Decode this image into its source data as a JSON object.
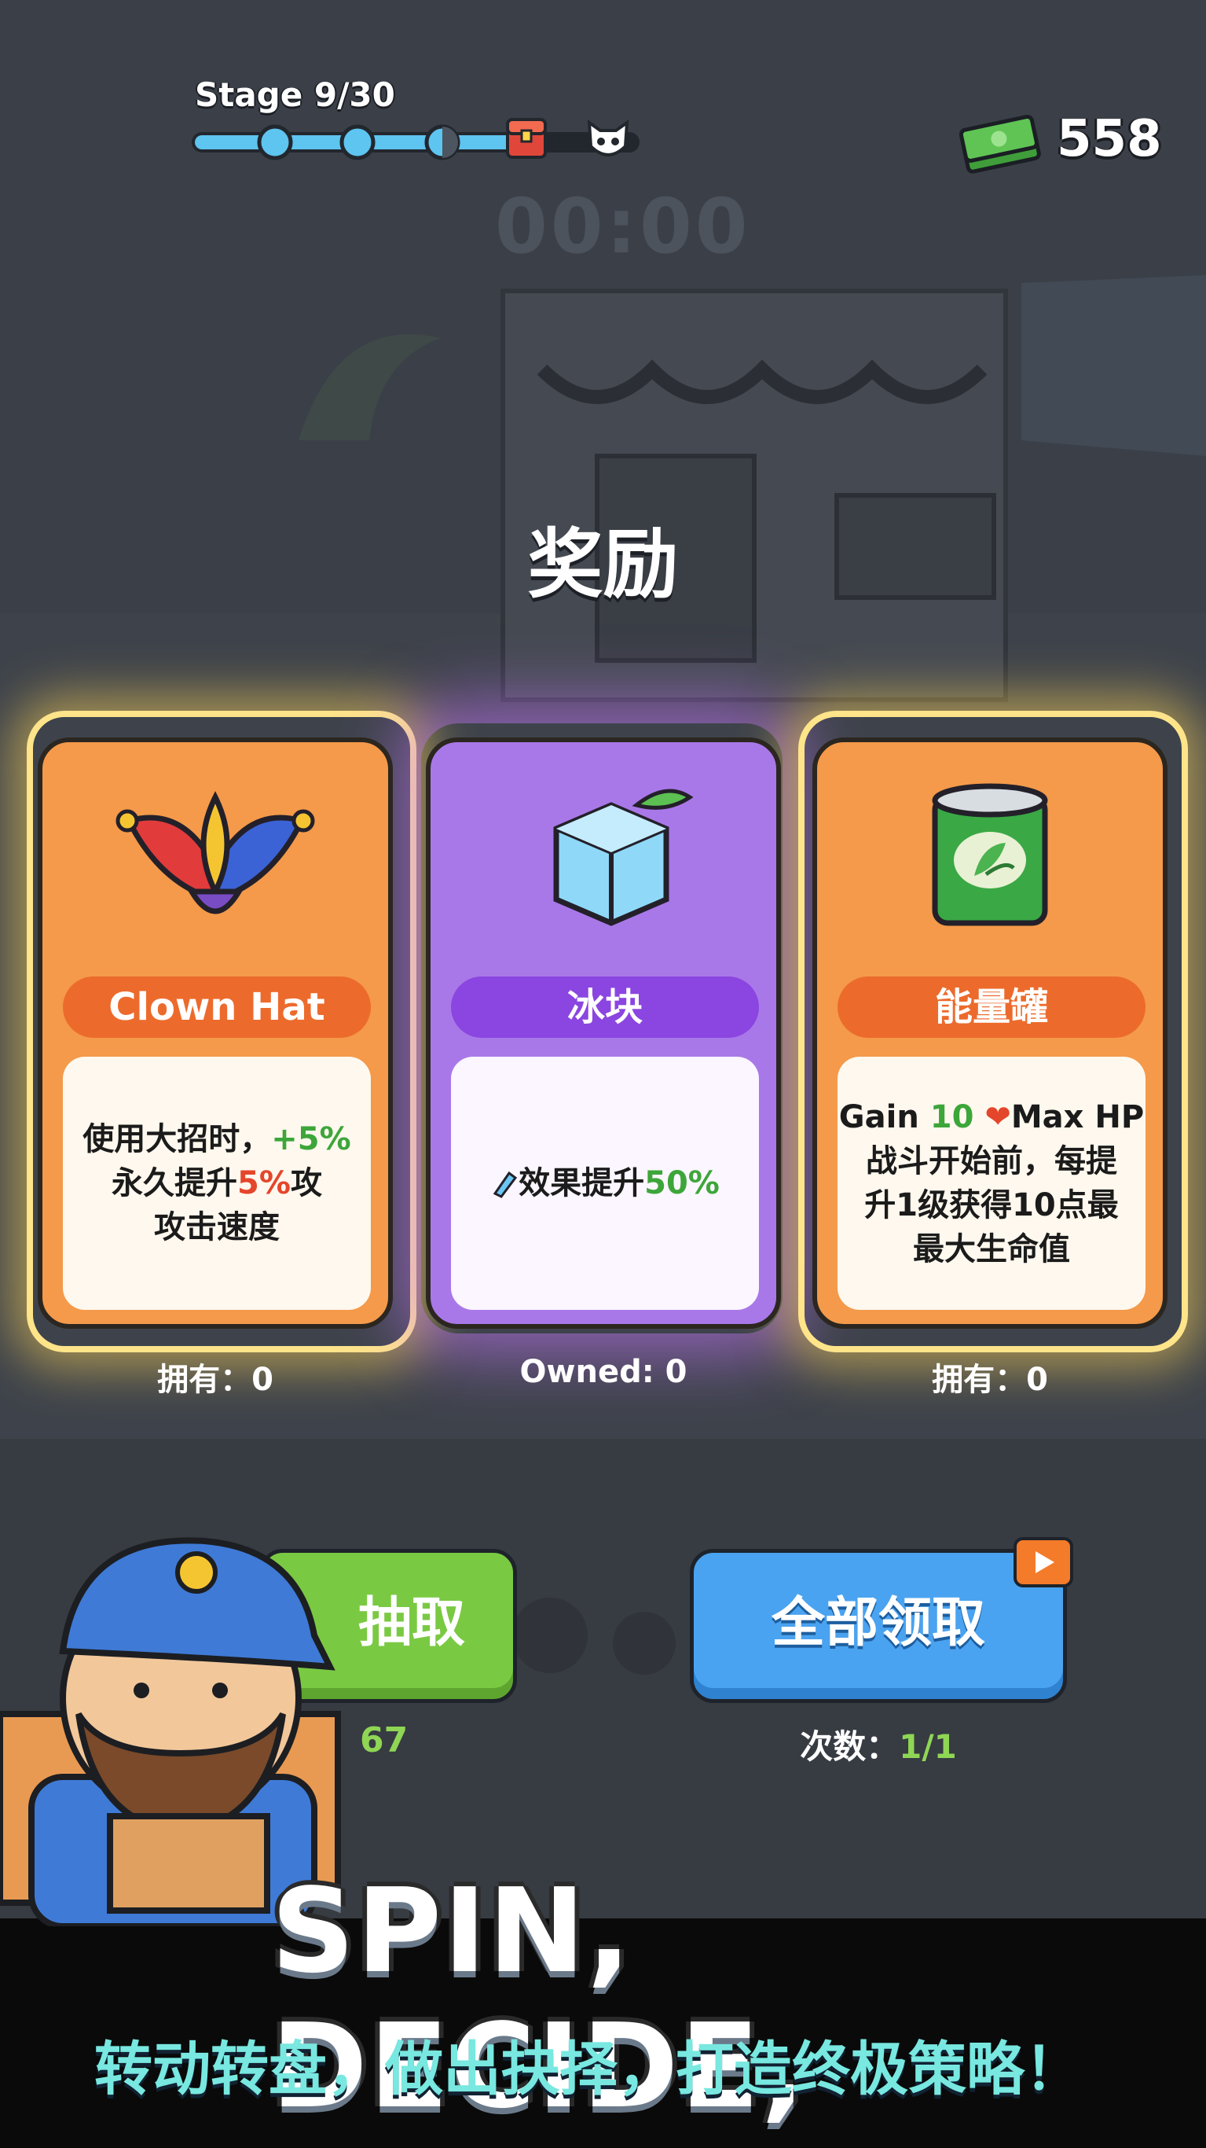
{
  "hud": {
    "stage_label": "Stage 9/30",
    "stage_progress": 0.72,
    "cash_value": "558",
    "timer": "00:00"
  },
  "title": "奖励",
  "cards": [
    {
      "name": "Clown Hat",
      "desc_line1_a": "使用大招时，",
      "desc_line1_b": "+5%",
      "desc_line2_a": "永久提升",
      "desc_line2_b": "5%",
      "desc_line2_c": "攻",
      "desc_line3": "攻击速度",
      "owned": "拥有：0"
    },
    {
      "name": "冰块",
      "desc_a": "效果提升",
      "desc_b": "50%",
      "owned": "Owned: 0"
    },
    {
      "name": "能量罐",
      "desc_line1_a": "Gain ",
      "desc_line1_b": "10",
      "desc_line1_c": "Max HP",
      "desc_line2": "战斗开始前，每提",
      "desc_line3": "升1级获得10点最",
      "desc_line4": "最大生命值",
      "owned": "拥有：0"
    }
  ],
  "buttons": {
    "draw_label": "抽取",
    "draw_count": "67",
    "claim_all_label": "全部领取",
    "claim_count_label": "次数：",
    "claim_count_value": "1/1"
  },
  "promo": {
    "title": "SPIN, DECIDE,",
    "subtitle": "转动转盘，做出抉择，打造终极策略！"
  }
}
